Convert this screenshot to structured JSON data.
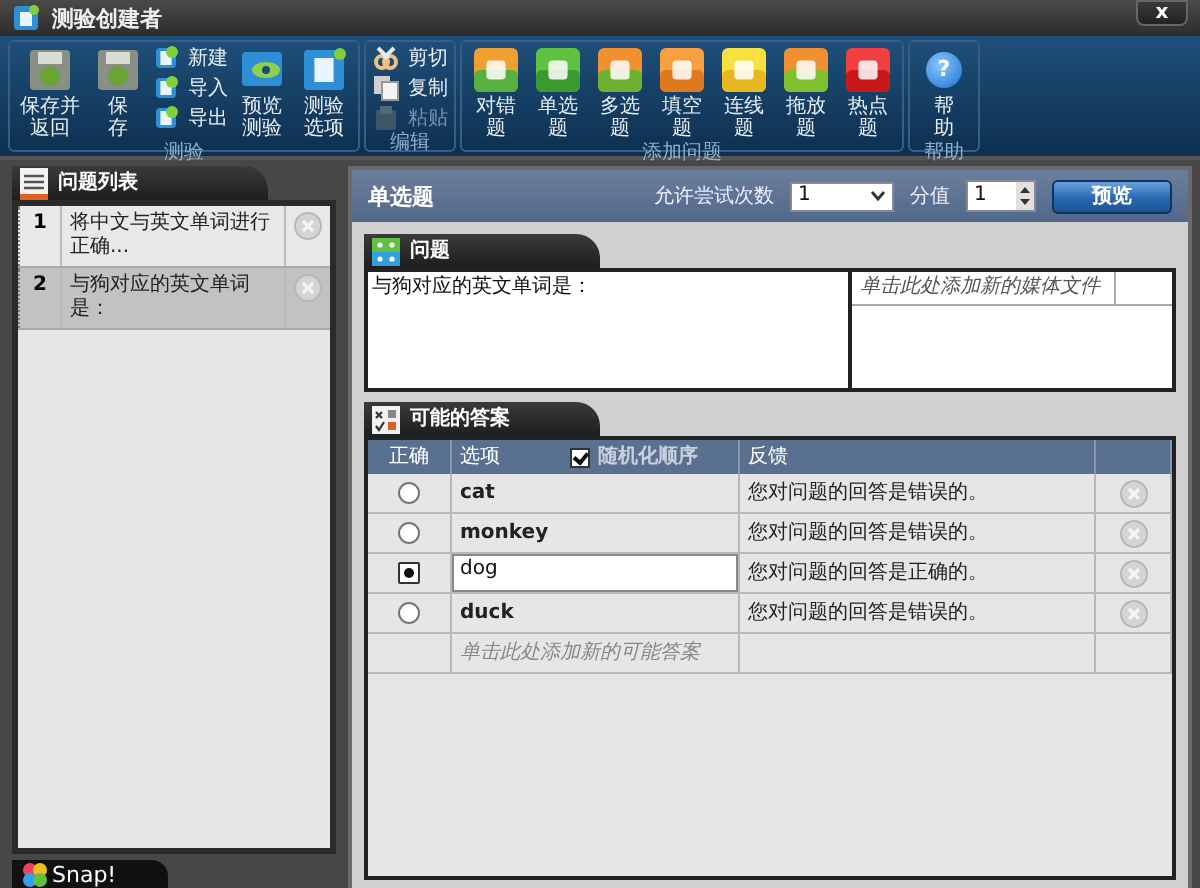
{
  "window": {
    "title": "测验创建者",
    "close": "x"
  },
  "ribbon": {
    "groups": [
      {
        "label": "测验",
        "buttons": [
          {
            "kind": "large",
            "label": "保存并返回",
            "disabled": false
          },
          {
            "kind": "large",
            "label": "保存",
            "disabled": false
          },
          {
            "kind": "small",
            "label": "新建",
            "disabled": false
          },
          {
            "kind": "small",
            "label": "导入",
            "disabled": false
          },
          {
            "kind": "small",
            "label": "导出",
            "disabled": false
          },
          {
            "kind": "large",
            "label": "预览测验",
            "disabled": false
          },
          {
            "kind": "large",
            "label": "测验选项",
            "disabled": false
          }
        ]
      },
      {
        "label": "编辑",
        "buttons": [
          {
            "kind": "small",
            "label": "剪切",
            "disabled": false
          },
          {
            "kind": "small",
            "label": "复制",
            "disabled": false
          },
          {
            "kind": "small",
            "label": "粘贴",
            "disabled": true
          }
        ]
      },
      {
        "label": "添加问题",
        "buttons": [
          {
            "kind": "large",
            "label": "对错题",
            "disabled": false
          },
          {
            "kind": "large",
            "label": "单选题",
            "disabled": false
          },
          {
            "kind": "large",
            "label": "多选题",
            "disabled": false
          },
          {
            "kind": "large",
            "label": "填空题",
            "disabled": false
          },
          {
            "kind": "large",
            "label": "连线题",
            "disabled": false
          },
          {
            "kind": "large",
            "label": "拖放题",
            "disabled": false
          },
          {
            "kind": "large",
            "label": "热点题",
            "disabled": false
          }
        ]
      },
      {
        "label": "帮助",
        "buttons": [
          {
            "kind": "large",
            "label": "帮助",
            "disabled": false,
            "icon_char": "?"
          }
        ]
      }
    ]
  },
  "question_list": {
    "title": "问题列表",
    "items": [
      {
        "number": "1",
        "text": "将中文与英文单词进行正确...",
        "selected": false
      },
      {
        "number": "2",
        "text": "与狗对应的英文单词是：",
        "selected": true
      }
    ]
  },
  "editor": {
    "type": "单选题",
    "attempts_label": "允许尝试次数",
    "attempts": "1",
    "score_label": "分值",
    "score": "1",
    "preview": "预览",
    "question": {
      "title": "问题",
      "text": "与狗对应的英文单词是：",
      "media_hint": "单击此处添加新的媒体文件"
    },
    "answers": {
      "title": "可能的答案",
      "columns": [
        "正确",
        "选项",
        "反馈"
      ],
      "randomize": {
        "label": "随机化顺序",
        "checked": true
      },
      "rows": [
        {
          "correct": false,
          "option": "cat",
          "feedback": "您对问题的回答是错误的。",
          "editing": false
        },
        {
          "correct": false,
          "option": "monkey",
          "feedback": "您对问题的回答是错误的。",
          "editing": false
        },
        {
          "correct": true,
          "option": "dog",
          "feedback": "您对问题的回答是正确的。",
          "editing": true
        },
        {
          "correct": false,
          "option": "duck",
          "feedback": "您对问题的回答是错误的。",
          "editing": false
        }
      ],
      "add_hint": "单击此处添加新的可能答案"
    }
  },
  "branding": {
    "logo": "Snap!"
  }
}
